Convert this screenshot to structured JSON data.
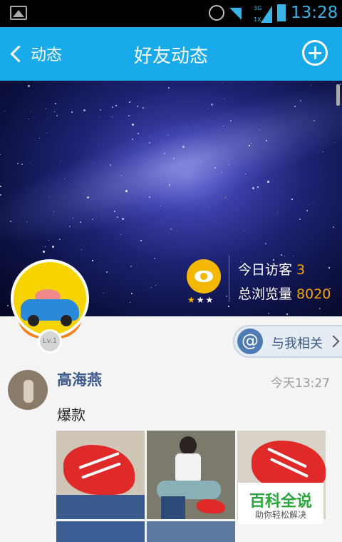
{
  "status_bar": {
    "time": "13:28",
    "network_labels": [
      "3G",
      "1X"
    ]
  },
  "title_bar": {
    "back_label": "动态",
    "title": "好友动态"
  },
  "profile": {
    "visitors_today_label": "今日访客",
    "visitors_today": "3",
    "total_views_label": "总浏览量",
    "total_views": "8020",
    "level_badge": "Lv.1",
    "rating_stars_on": 1,
    "rating_stars_total": 3
  },
  "about_me": {
    "label": "与我相关"
  },
  "post": {
    "author": "高海燕",
    "time": "今天13:27",
    "text": "爆款"
  },
  "watermark": {
    "title": "百科全说",
    "subtitle": "助你轻松解决"
  },
  "colors": {
    "accent": "#19aaea",
    "number_highlight": "#f5a300",
    "author_blue": "#3d5a8c"
  }
}
